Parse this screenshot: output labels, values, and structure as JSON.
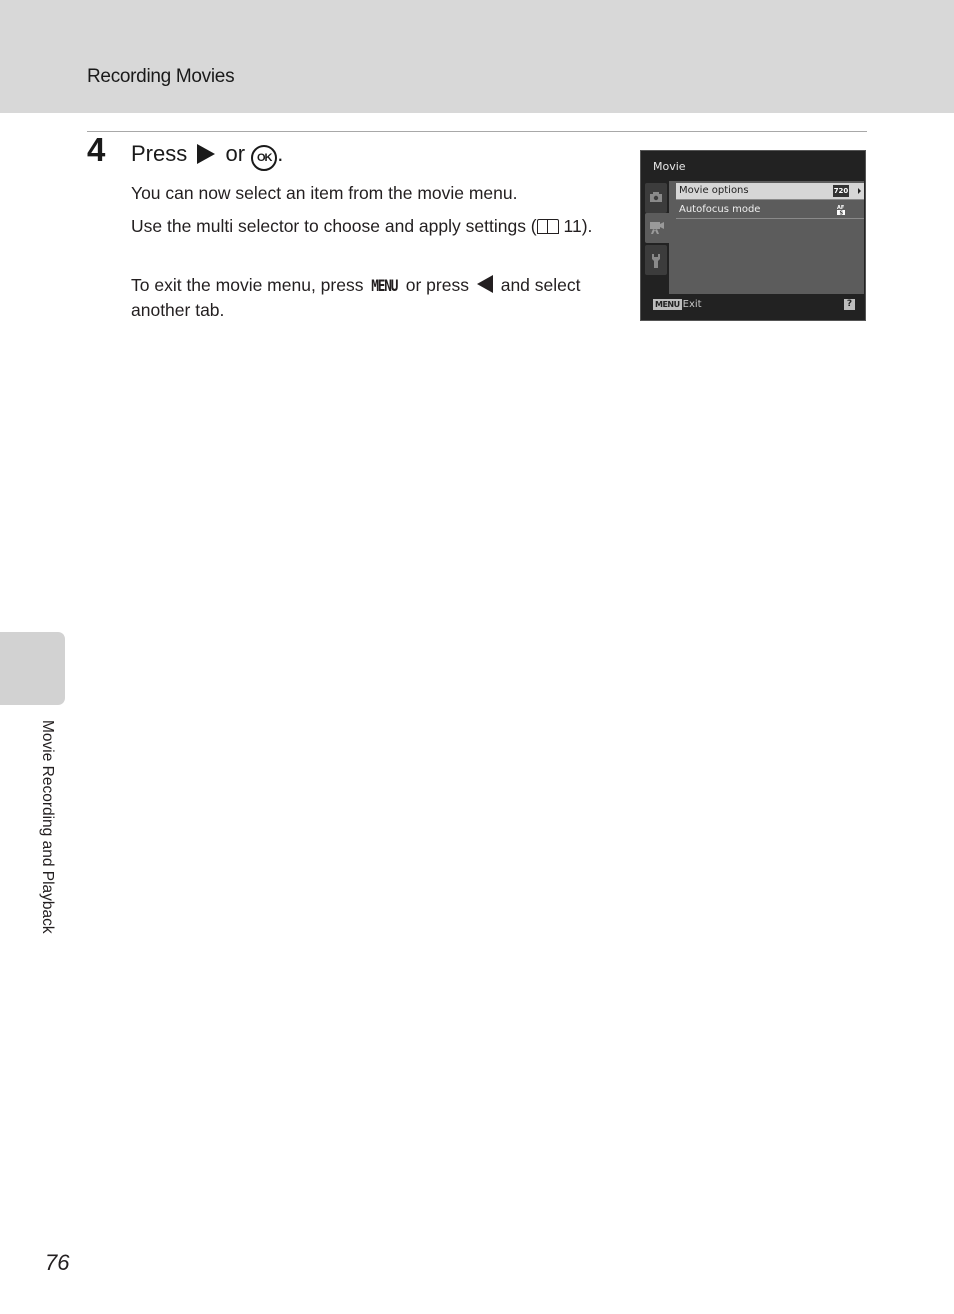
{
  "header": {
    "section_title": "Recording Movies"
  },
  "step": {
    "number": "4",
    "heading_prefix": "Press",
    "heading_or": "or",
    "heading_ok": "OK",
    "heading_suffix": ".",
    "paragraphs": {
      "p1": "You can now select an item from the movie menu.",
      "p2_a": "Use the multi selector to choose and apply settings (",
      "p2_ref": "11",
      "p2_b": ").",
      "p3_a": "To exit the movie menu, press",
      "p3_menu": "MENU",
      "p3_b": "or press",
      "p3_c": "and select another tab."
    }
  },
  "camera_screen": {
    "title": "Movie",
    "tabs": [
      {
        "name": "shooting",
        "icon": "camera-icon",
        "active": false
      },
      {
        "name": "movie",
        "icon": "movie-camera-icon",
        "active": true
      },
      {
        "name": "setup",
        "icon": "wrench-icon",
        "active": false
      }
    ],
    "menu_items": [
      {
        "label": "Movie options",
        "value_icon": "720",
        "selected": true
      },
      {
        "label": "Autofocus mode",
        "value_icon": "AF-S",
        "selected": false
      }
    ],
    "footer": {
      "menu_button": "MENU",
      "exit_label": "Exit",
      "help_button": "?"
    }
  },
  "side_tab": {
    "label": "Movie Recording and Playback"
  },
  "page_number": "76"
}
